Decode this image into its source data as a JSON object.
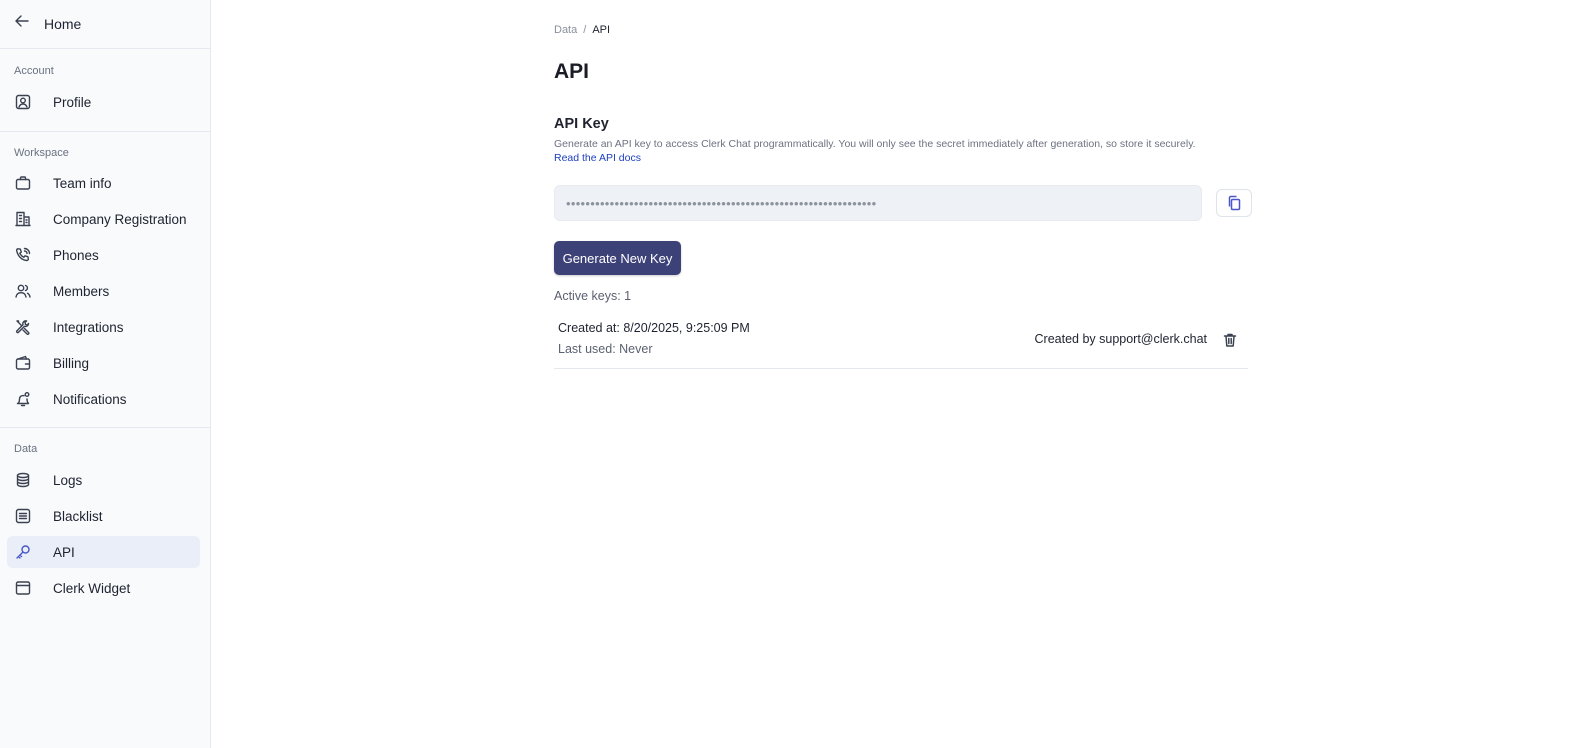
{
  "sidebar": {
    "home_label": "Home",
    "sections": [
      {
        "title": "Account",
        "items": [
          {
            "label": "Profile",
            "icon": "profile-icon"
          }
        ]
      },
      {
        "title": "Workspace",
        "items": [
          {
            "label": "Team info",
            "icon": "briefcase-icon"
          },
          {
            "label": "Company Registration",
            "icon": "building-icon"
          },
          {
            "label": "Phones",
            "icon": "phone-icon"
          },
          {
            "label": "Members",
            "icon": "members-icon"
          },
          {
            "label": "Integrations",
            "icon": "tools-icon"
          },
          {
            "label": "Billing",
            "icon": "wallet-icon"
          },
          {
            "label": "Notifications",
            "icon": "bell-icon"
          }
        ]
      },
      {
        "title": "Data",
        "items": [
          {
            "label": "Logs",
            "icon": "database-icon"
          },
          {
            "label": "Blacklist",
            "icon": "list-box-icon"
          },
          {
            "label": "API",
            "icon": "key-icon",
            "active": true
          },
          {
            "label": "Clerk Widget",
            "icon": "window-icon"
          }
        ]
      }
    ]
  },
  "breadcrumb": {
    "parent": "Data",
    "separator": "/",
    "current": "API"
  },
  "page": {
    "title": "API",
    "section_title": "API Key",
    "description": "Generate an API key to access Clerk Chat programmatically. You will only see the secret immediately after generation, so store it securely.",
    "docs_link": "Read the API docs",
    "key_value": "••••••••••••••••••••••••••••••••••••••••••••••••••••••••••••••••",
    "generate_button": "Generate New Key",
    "active_keys": "Active keys: 1",
    "keys": [
      {
        "created_at": "Created at: 8/20/2025, 9:25:09 PM",
        "last_used": "Last used: Never",
        "created_by": "Created by support@clerk.chat"
      }
    ]
  },
  "colors": {
    "primary_button": "#3c4178",
    "active_nav": "#eaeef8",
    "link": "#1d3fbf",
    "accent_icon": "#4a57c8"
  }
}
